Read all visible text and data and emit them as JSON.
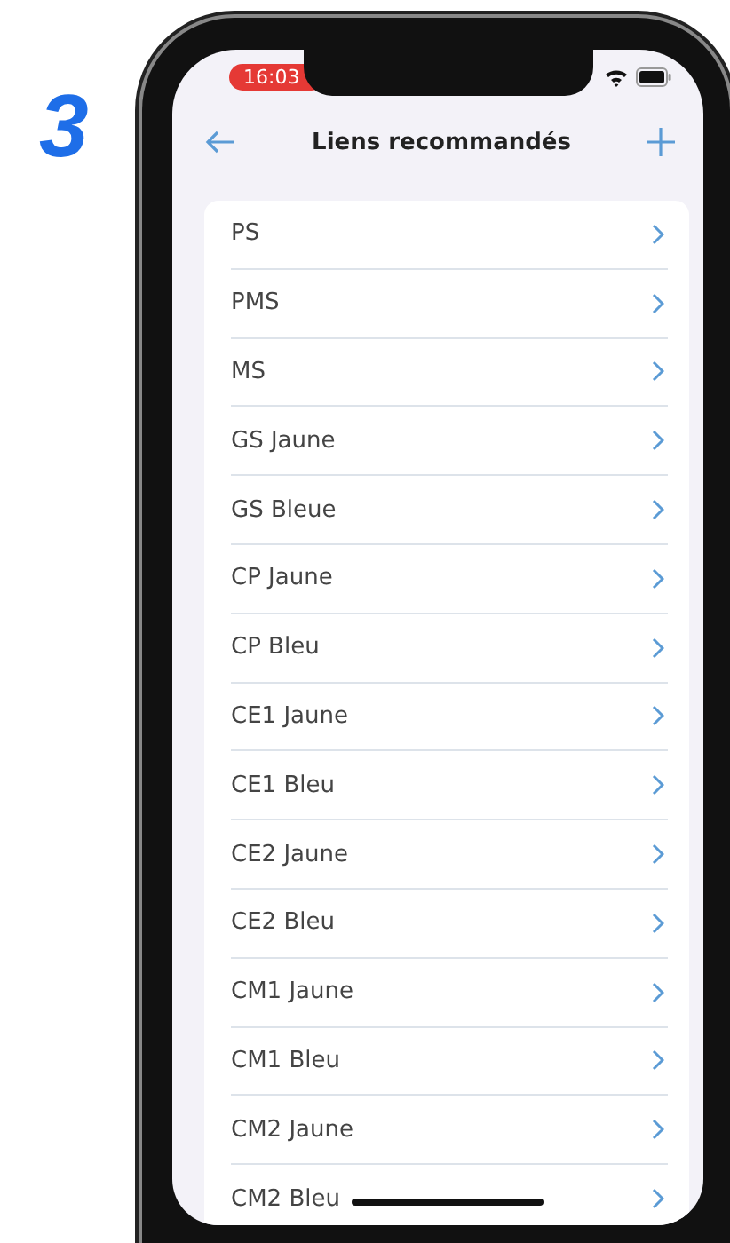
{
  "step_number": "3",
  "status_bar": {
    "time": "16:03"
  },
  "header": {
    "title": "Liens recommandés"
  },
  "links": [
    {
      "label": "PS"
    },
    {
      "label": "PMS"
    },
    {
      "label": "MS"
    },
    {
      "label": "GS Jaune"
    },
    {
      "label": "GS Bleue"
    },
    {
      "label": "CP Jaune"
    },
    {
      "label": "CP Bleu"
    },
    {
      "label": "CE1 Jaune"
    },
    {
      "label": "CE1 Bleu"
    },
    {
      "label": "CE2 Jaune"
    },
    {
      "label": "CE2 Bleu"
    },
    {
      "label": "CM1 Jaune"
    },
    {
      "label": "CM1 Bleu"
    },
    {
      "label": "CM2 Jaune"
    },
    {
      "label": "CM2 Bleu"
    }
  ]
}
